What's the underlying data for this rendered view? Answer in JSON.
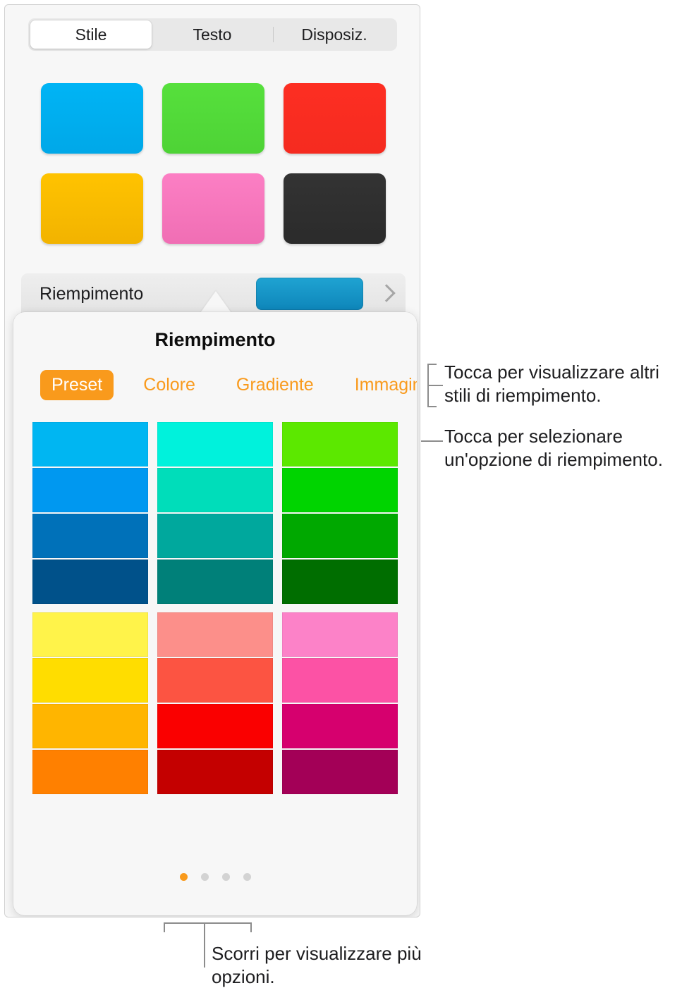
{
  "panel": {
    "segmented_control": {
      "options": [
        {
          "label": "Stile",
          "selected": true
        },
        {
          "label": "Testo",
          "selected": false
        },
        {
          "label": "Disposiz.",
          "selected": false
        }
      ]
    },
    "style_presets": {
      "swatches": [
        {
          "name": "blue-style",
          "color": "#00b4f5",
          "color2": "#00a8e8"
        },
        {
          "name": "green-style",
          "color": "#56e03c",
          "color2": "#4ed336"
        },
        {
          "name": "red-style",
          "color": "#fd2e22",
          "color2": "#f52b20"
        },
        {
          "name": "yellow-style",
          "color": "#ffc300",
          "color2": "#f2b300"
        },
        {
          "name": "pink-style",
          "color": "#fc7fc4",
          "color2": "#f06eb4"
        },
        {
          "name": "dark-style",
          "color": "#333333",
          "color2": "#2b2b2b"
        }
      ]
    },
    "fill_row": {
      "label": "Riempimento",
      "swatch_color": "#0e86ba",
      "disclosure_icon": "chevron-right-icon"
    }
  },
  "popover": {
    "title": "Riempimento",
    "tabs": [
      {
        "label": "Preset",
        "selected": true
      },
      {
        "label": "Colore",
        "selected": false
      },
      {
        "label": "Gradiente",
        "selected": false
      },
      {
        "label": "Immagine",
        "selected": false
      }
    ],
    "accent_color": "#f99a1c",
    "grids": [
      {
        "name": "cool-colors",
        "columns": [
          {
            "name": "blue-column",
            "cells": [
              "#00b6f2",
              "#0098f0",
              "#0071b9",
              "#00518a"
            ]
          },
          {
            "name": "teal-column",
            "cells": [
              "#00f2dc",
              "#00ddba",
              "#00a89d",
              "#008079"
            ]
          },
          {
            "name": "green-column",
            "cells": [
              "#5ce800",
              "#00d400",
              "#00a800",
              "#006e00"
            ]
          }
        ]
      },
      {
        "name": "warm-colors",
        "columns": [
          {
            "name": "yellow-column",
            "cells": [
              "#fff34a",
              "#ffdd00",
              "#ffb500",
              "#ff8000"
            ]
          },
          {
            "name": "red-column",
            "cells": [
              "#fc8f8a",
              "#fc5442",
              "#fa0000",
              "#c40000"
            ]
          },
          {
            "name": "magenta-column",
            "cells": [
              "#fc82c8",
              "#fc52a5",
              "#d6006e",
              "#a30057"
            ]
          }
        ]
      }
    ],
    "page_dots": {
      "count": 4,
      "active_index": 0
    }
  },
  "callouts": [
    {
      "name": "callout-more-fill-styles",
      "text": "Tocca per visualizzare altri stili di riempimento."
    },
    {
      "name": "callout-select-fill-option",
      "text": "Tocca per selezionare un'opzione di riempimento."
    },
    {
      "name": "callout-scroll-more-options",
      "text": "Scorri per visualizzare più opzioni."
    }
  ]
}
